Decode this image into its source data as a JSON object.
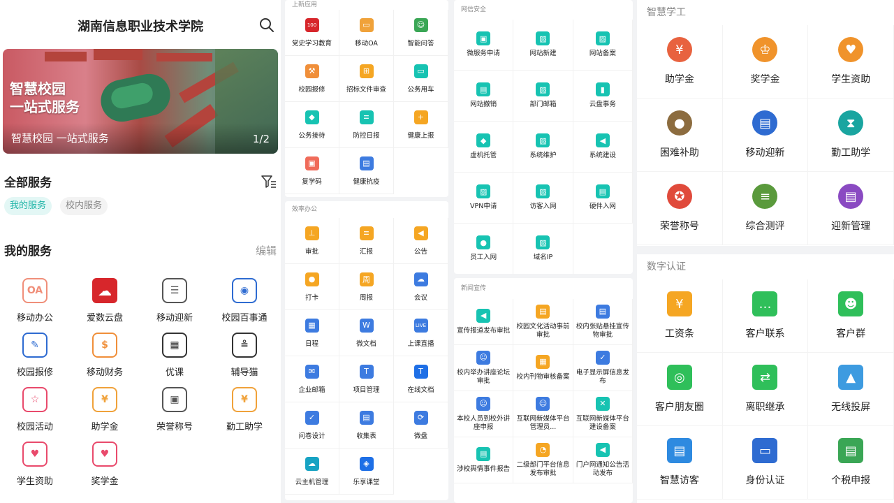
{
  "panel1": {
    "title": "湖南信息职业技术学院",
    "banner_line1": "智慧校园",
    "banner_line2": "一站式服务",
    "banner_caption": "智慧校园 一站式服务",
    "banner_page": "1/2",
    "all_services": "全部服务",
    "tab_my": "我的服务",
    "tab_campus": "校内服务",
    "my_services": "我的服务",
    "edit": "编辑",
    "services": [
      {
        "label": "移动办公",
        "icon": "mobile-office-icon",
        "color": "#f08f7a"
      },
      {
        "label": "爱数云盘",
        "icon": "cloud-disk-icon",
        "color": "#d7262b"
      },
      {
        "label": "移动迎新",
        "icon": "welcome-doc-icon",
        "color": "#555555"
      },
      {
        "label": "校园百事通",
        "icon": "robot-icon",
        "color": "#2e6bd1"
      },
      {
        "label": "校园报修",
        "icon": "repair-doc-icon",
        "color": "#2e6bd1"
      },
      {
        "label": "移动财务",
        "icon": "finance-icon",
        "color": "#f08f3a"
      },
      {
        "label": "优课",
        "icon": "calendar-icon",
        "color": "#333333"
      },
      {
        "label": "辅导猫",
        "icon": "cat-icon",
        "color": "#333333"
      },
      {
        "label": "校园活动",
        "icon": "star-icon",
        "color": "#e94a6c"
      },
      {
        "label": "助学金",
        "icon": "money-bag-icon",
        "color": "#f0a23a"
      },
      {
        "label": "荣誉称号",
        "icon": "certificate-icon",
        "color": "#555555"
      },
      {
        "label": "勤工助学",
        "icon": "work-study-icon",
        "color": "#f0a23a"
      },
      {
        "label": "学生资助",
        "icon": "heart-hand-icon",
        "color": "#e94a6c"
      },
      {
        "label": "奖学金",
        "icon": "heart-house-icon",
        "color": "#e94a6c"
      }
    ]
  },
  "panel2": {
    "new_apps": {
      "title": "上新应用",
      "items": [
        {
          "label": "党史学习教育",
          "icon": "party-history-icon",
          "color": "#d7262b"
        },
        {
          "label": "移动OA",
          "icon": "monitor-icon",
          "color": "#f0a23a"
        },
        {
          "label": "智能问答",
          "icon": "assistant-icon",
          "color": "#3aa655"
        },
        {
          "label": "校园报修",
          "icon": "repair-icon",
          "color": "#f08f3a"
        },
        {
          "label": "招标文件审查",
          "icon": "cart-icon",
          "color": "#f5a623"
        },
        {
          "label": "公务用车",
          "icon": "car-icon",
          "color": "#17c3b2"
        },
        {
          "label": "公务接待",
          "icon": "diamond-icon",
          "color": "#17c3b2"
        },
        {
          "label": "防控日报",
          "icon": "report-icon",
          "color": "#17c3b2"
        },
        {
          "label": "健康上报",
          "icon": "health-icon",
          "color": "#f5a623"
        },
        {
          "label": "复学码",
          "icon": "qr-icon",
          "color": "#f06b5a"
        },
        {
          "label": "健康抗疫",
          "icon": "briefcase-icon",
          "color": "#3d7be0"
        }
      ]
    },
    "office": {
      "title": "效率办公",
      "items": [
        {
          "label": "审批",
          "icon": "stamp-icon",
          "color": "#f5a623"
        },
        {
          "label": "汇报",
          "icon": "doc-icon",
          "color": "#f5a623"
        },
        {
          "label": "公告",
          "icon": "megaphone-icon",
          "color": "#f5a623"
        },
        {
          "label": "打卡",
          "icon": "location-icon",
          "color": "#f5a623"
        },
        {
          "label": "周报",
          "icon": "weekly-icon",
          "color": "#f5a623"
        },
        {
          "label": "会议",
          "icon": "cloud-icon",
          "color": "#3d7be0"
        },
        {
          "label": "日程",
          "icon": "grid-icon",
          "color": "#3d7be0"
        },
        {
          "label": "微文档",
          "icon": "word-icon",
          "color": "#3d7be0"
        },
        {
          "label": "上课直播",
          "icon": "live-icon",
          "color": "#3d7be0"
        },
        {
          "label": "企业邮箱",
          "icon": "mail-icon",
          "color": "#3d7be0"
        },
        {
          "label": "项目管理",
          "icon": "teambition-icon",
          "color": "#3d7be0"
        },
        {
          "label": "在线文档",
          "icon": "tencent-doc-icon",
          "color": "#1e6fe6"
        },
        {
          "label": "问卷设计",
          "icon": "check-icon",
          "color": "#3d7be0"
        },
        {
          "label": "收集表",
          "icon": "form-icon",
          "color": "#3d7be0"
        },
        {
          "label": "微盘",
          "icon": "weipan-icon",
          "color": "#3d7be0"
        },
        {
          "label": "云主机管理",
          "icon": "cloud-host-icon",
          "color": "#17a3c3"
        },
        {
          "label": "乐享课堂",
          "icon": "lexiang-icon",
          "color": "#1e6fe6"
        }
      ]
    }
  },
  "panel3": {
    "net_security": {
      "title": "网信安全",
      "items": [
        {
          "label": "微服务申请",
          "icon": "app-icon"
        },
        {
          "label": "网站新建",
          "icon": "image-icon"
        },
        {
          "label": "网站备案",
          "icon": "image-icon"
        },
        {
          "label": "网站撤销",
          "icon": "id-card-icon"
        },
        {
          "label": "部门邮箱",
          "icon": "image-icon"
        },
        {
          "label": "云盘事务",
          "icon": "bar-icon"
        },
        {
          "label": "虚机托管",
          "icon": "diamond-icon"
        },
        {
          "label": "系统维护",
          "icon": "image-icon"
        },
        {
          "label": "系统建设",
          "icon": "megaphone-icon"
        },
        {
          "label": "VPN申请",
          "icon": "image-icon"
        },
        {
          "label": "访客入网",
          "icon": "image-icon"
        },
        {
          "label": "硬件入网",
          "icon": "id-card-icon"
        },
        {
          "label": "员工入网",
          "icon": "person-icon"
        },
        {
          "label": "域名IP",
          "icon": "image-icon"
        }
      ]
    },
    "news": {
      "title": "新闻宣传",
      "items": [
        {
          "label": "宣传报道发布审批",
          "icon": "megaphone-icon",
          "color": "#17c3b2"
        },
        {
          "label": "校园文化活动事前审批",
          "icon": "board-icon",
          "color": "#f5a623"
        },
        {
          "label": "校内张贴悬挂宣传物审批",
          "icon": "print-icon",
          "color": "#3d7be0"
        },
        {
          "label": "校内举办讲座论坛审批",
          "icon": "speaker-icon",
          "color": "#3d7be0"
        },
        {
          "label": "校内刊物审核备案",
          "icon": "calendar2-icon",
          "color": "#f5a623"
        },
        {
          "label": "电子显示屏信息发布",
          "icon": "clipboard-icon",
          "color": "#3d7be0"
        },
        {
          "label": "本校人员到校外讲座申报",
          "icon": "speaker-icon",
          "color": "#3d7be0"
        },
        {
          "label": "互联网新媒体平台管理员...",
          "icon": "speaker-icon",
          "color": "#3d7be0"
        },
        {
          "label": "互联网新媒体平台建设备案",
          "icon": "tools-icon",
          "color": "#17c3b2"
        },
        {
          "label": "涉校舆情事件报告",
          "icon": "id-card-icon",
          "color": "#17c3b2"
        },
        {
          "label": "二级部门平台信息发布审批",
          "icon": "clock-icon",
          "color": "#f5a623"
        },
        {
          "label": "门户网通知公告活动发布",
          "icon": "megaphone-icon",
          "color": "#17c3b2"
        }
      ]
    }
  },
  "panel4": {
    "smart_student": {
      "title": "智慧学工",
      "items": [
        {
          "label": "助学金",
          "icon": "grant-icon",
          "color": "#e8623f"
        },
        {
          "label": "奖学金",
          "icon": "trophy-icon",
          "color": "#f0932b"
        },
        {
          "label": "学生资助",
          "icon": "support-hand-icon",
          "color": "#f0932b"
        },
        {
          "label": "困难补助",
          "icon": "subsidy-icon",
          "color": "#8c6c3f"
        },
        {
          "label": "移动迎新",
          "icon": "welcome-icon",
          "color": "#2e6bd1"
        },
        {
          "label": "勤工助学",
          "icon": "hourglass-icon",
          "color": "#1aa5a0"
        },
        {
          "label": "荣誉称号",
          "icon": "medal-icon",
          "color": "#e04a3b"
        },
        {
          "label": "综合测评",
          "icon": "clipboard2-icon",
          "color": "#5a9a3c"
        },
        {
          "label": "迎新管理",
          "icon": "welcome-manage-icon",
          "color": "#8a4ac2"
        }
      ]
    },
    "digital_auth": {
      "title": "数字认证",
      "items": [
        {
          "label": "工资条",
          "icon": "salary-icon",
          "color": "#f5a623"
        },
        {
          "label": "客户联系",
          "icon": "chat-icon",
          "color": "#2fbf5a"
        },
        {
          "label": "客户群",
          "icon": "group-icon",
          "color": "#2fbf5a"
        },
        {
          "label": "客户朋友圈",
          "icon": "moments-icon",
          "color": "#2fbf5a"
        },
        {
          "label": "离职继承",
          "icon": "transfer-icon",
          "color": "#2fbf5a"
        },
        {
          "label": "无线投屏",
          "icon": "cast-icon",
          "color": "#3d9be0"
        },
        {
          "label": "智慧访客",
          "icon": "visitor-icon",
          "color": "#2e8ae0"
        },
        {
          "label": "身份认证",
          "icon": "computer-icon",
          "color": "#2e6bd1"
        },
        {
          "label": "个税申报",
          "icon": "tax-icon",
          "color": "#3aa655"
        }
      ]
    }
  }
}
